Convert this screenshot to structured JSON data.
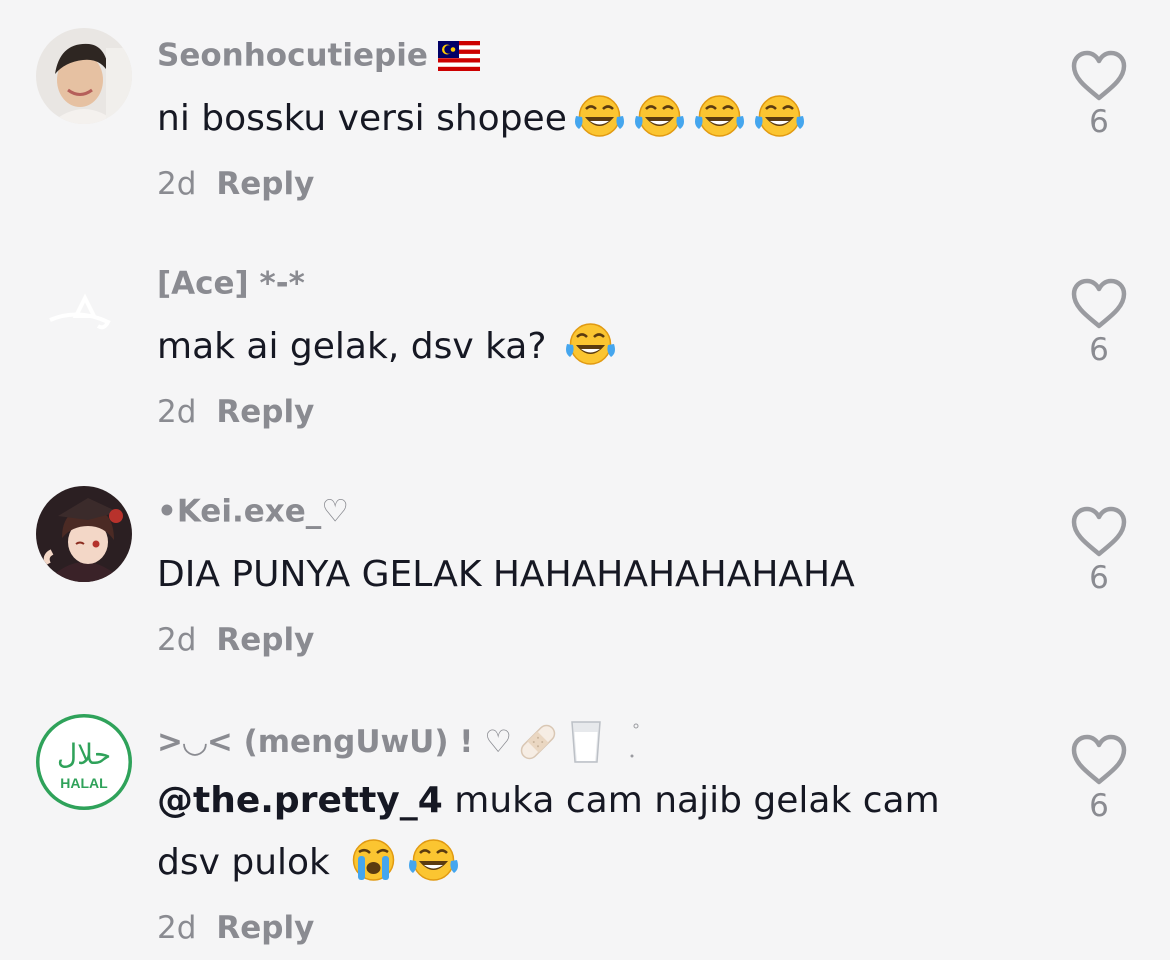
{
  "colors": {
    "background": "#f5f5f6",
    "text_primary": "#161823",
    "text_secondary": "#8a8b91",
    "halal_green": "#2fa25a"
  },
  "comments": [
    {
      "username": "Seonhocutiepie",
      "username_decoration": "malaysia-flag-icon",
      "text": "ni bossku versi shopee",
      "emojis": [
        "tears-of-joy-emoji",
        "tears-of-joy-emoji",
        "tears-of-joy-emoji",
        "tears-of-joy-emoji"
      ],
      "age": "2d",
      "reply_label": "Reply",
      "likes": "6"
    },
    {
      "username": "[Ace] *-*",
      "text": "mak ai gelak, dsv ka?",
      "emojis": [
        "tears-of-joy-emoji"
      ],
      "age": "2d",
      "reply_label": "Reply",
      "likes": "6"
    },
    {
      "username": "•Kei.exe_♡",
      "text": "DIA PUNYA GELAK HAHAHAHAHAHAHA",
      "age": "2d",
      "reply_label": "Reply",
      "likes": "6"
    },
    {
      "username": ">◡< (mengUwU) ! ♡",
      "username_decoration": [
        "bandage-icon",
        "milk-glass-icon"
      ],
      "mention": "@the.pretty_4",
      "text_line1": " muka cam najib gelak cam",
      "text_line2": "dsv pulok",
      "emojis": [
        "loudly-crying-emoji",
        "tears-of-joy-emoji"
      ],
      "avatar_text": "HALAL",
      "avatar_script": "حلال",
      "age": "2d",
      "reply_label": "Reply",
      "likes": "6"
    }
  ]
}
